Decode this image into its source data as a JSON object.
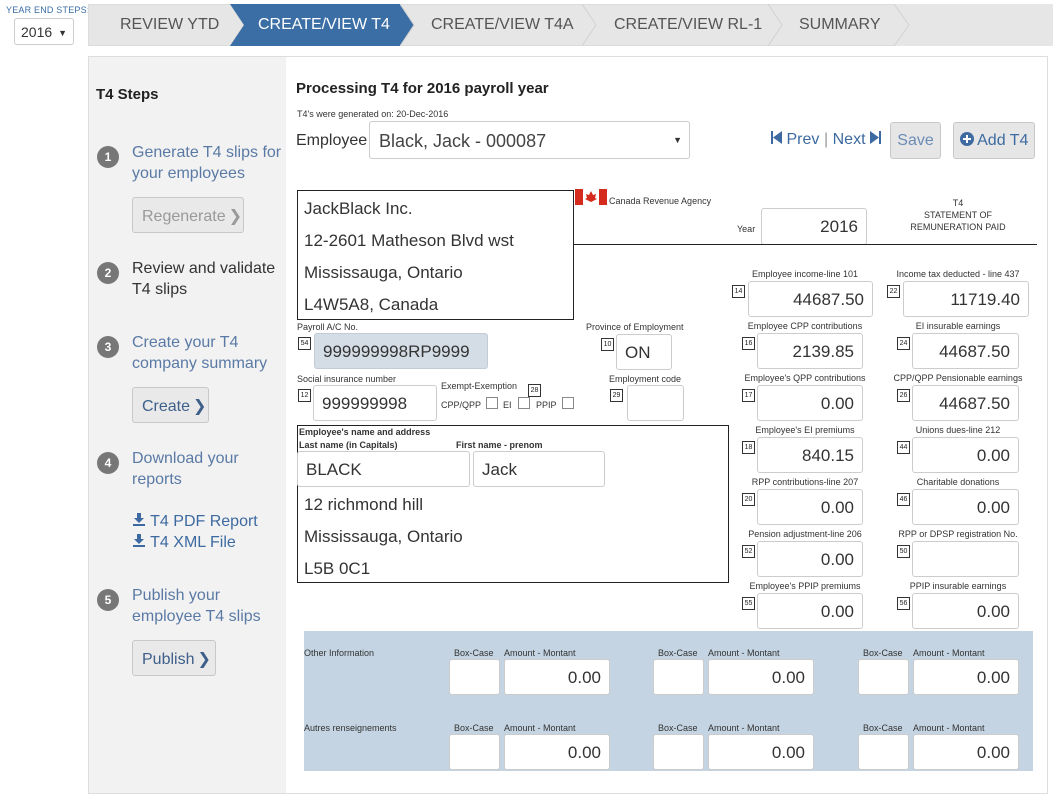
{
  "topbar": {
    "year_end_label": "YEAR END STEPS:",
    "year_value": "2016",
    "tabs": [
      {
        "label": "REVIEW YTD"
      },
      {
        "label": "CREATE/VIEW T4"
      },
      {
        "label": "CREATE/VIEW T4A"
      },
      {
        "label": "CREATE/VIEW RL-1"
      },
      {
        "label": "SUMMARY"
      }
    ]
  },
  "sidebar": {
    "title": "T4 Steps",
    "steps": [
      {
        "num": "1",
        "text": "Generate T4 slips for your employees",
        "button": "Regenerate"
      },
      {
        "num": "2",
        "text": "Review and validate T4 slips"
      },
      {
        "num": "3",
        "text": "Create your T4 company summary",
        "button": "Create"
      },
      {
        "num": "4",
        "text": "Download your reports",
        "links": [
          "T4 PDF Report",
          "T4 XML File"
        ]
      },
      {
        "num": "5",
        "text": "Publish your employee T4 slips",
        "button": "Publish"
      }
    ]
  },
  "header": {
    "title": "Processing T4 for 2016 payroll year",
    "generated_on": "T4's were generated on: 20-Dec-2016",
    "employee_label": "Employee",
    "employee_value": "Black, Jack - 000087",
    "prev_label": "Prev",
    "next_label": "Next",
    "save_label": "Save",
    "add_label": "Add T4"
  },
  "form": {
    "employer_address": [
      "JackBlack Inc.",
      "12-2601 Matheson Blvd wst",
      "Mississauga, Ontario",
      "L4W5A8, Canada"
    ],
    "agency": "Canada Revenue Agency",
    "year_label": "Year",
    "year_value": "2016",
    "statement_title": [
      "T4",
      "STATEMENT OF",
      "REMUNERATION PAID"
    ],
    "payroll_label": "Payroll A/C No.",
    "payroll_box": "54",
    "payroll_value": "999999998RP9999",
    "province_label": "Province of Employment",
    "province_box": "10",
    "province_value": "ON",
    "sin_label": "Social insurance number",
    "sin_box": "12",
    "sin_value": "999999998",
    "exempt_label": "Exempt-Exemption",
    "exempt_box": "28",
    "exempt_options": [
      "CPP/QPP",
      "EI",
      "PPIP"
    ],
    "emp_code_label": "Employment code",
    "emp_code_box": "29",
    "emp_code_value": "",
    "employee_section_label": "Employee's name and address",
    "last_name_label": "Last name (in Capitals)",
    "first_name_label": "First name - prenom",
    "last_name": "BLACK",
    "first_name": "Jack",
    "employee_address": [
      "12 richmond hill",
      "Mississauga, Ontario",
      "L5B 0C1"
    ],
    "boxes": [
      {
        "label": "Employee income-line 101",
        "box": "14",
        "value": "44687.50"
      },
      {
        "label": "Income tax deducted - line 437",
        "box": "22",
        "value": "11719.40"
      },
      {
        "label": "Employee CPP contributions",
        "box": "16",
        "value": "2139.85"
      },
      {
        "label": "EI insurable earnings",
        "box": "24",
        "value": "44687.50"
      },
      {
        "label": "Employee's QPP contributions",
        "box": "17",
        "value": "0.00"
      },
      {
        "label": "CPP/QPP Pensionable earnings",
        "box": "26",
        "value": "44687.50"
      },
      {
        "label": "Employee's EI premiums",
        "box": "18",
        "value": "840.15"
      },
      {
        "label": "Unions dues-line 212",
        "box": "44",
        "value": "0.00"
      },
      {
        "label": "RPP contributions-line 207",
        "box": "20",
        "value": "0.00"
      },
      {
        "label": "Charitable donations",
        "box": "46",
        "value": "0.00"
      },
      {
        "label": "Pension adjustment-line 206",
        "box": "52",
        "value": "0.00"
      },
      {
        "label": "RPP or DPSP registration No.",
        "box": "50",
        "value": ""
      },
      {
        "label": "Employee's PPIP premiums",
        "box": "55",
        "value": "0.00"
      },
      {
        "label": "PPIP insurable earnings",
        "box": "56",
        "value": "0.00"
      }
    ],
    "other_info": {
      "row_labels": [
        "Other Information",
        "Autres renseignements"
      ],
      "box_label": "Box-Case",
      "amount_label": "Amount - Montant",
      "amounts": [
        [
          "0.00",
          "0.00",
          "0.00"
        ],
        [
          "0.00",
          "0.00",
          "0.00"
        ]
      ]
    }
  },
  "colors": {
    "active_tab": "#3a6ea5",
    "link": "#3d6aa0",
    "panel": "#c4d4e2",
    "step_circle": "#777777"
  }
}
